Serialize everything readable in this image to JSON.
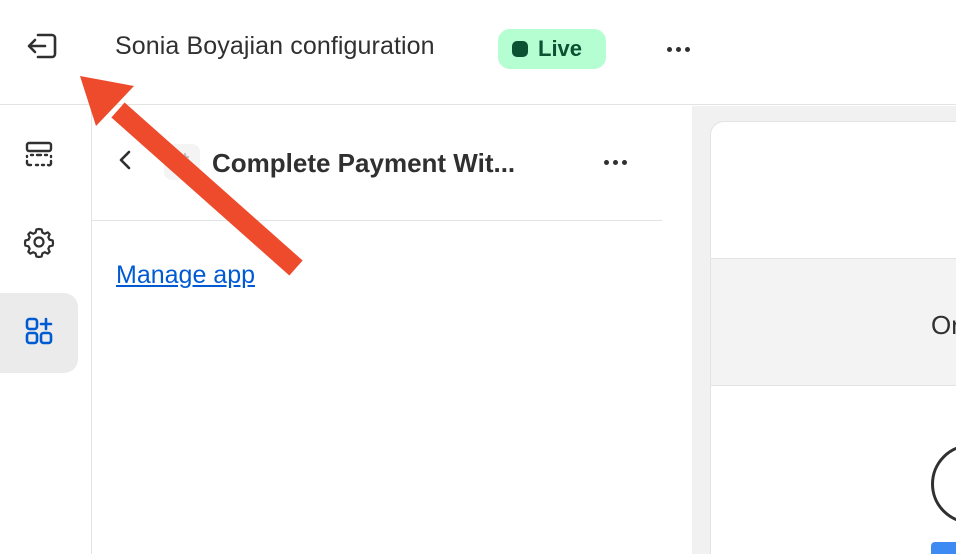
{
  "topbar": {
    "title": "Sonia Boyajian configuration",
    "status_badge": "Live",
    "status_color": "#0c5132",
    "status_bg": "#b4fed2",
    "exit_icon": "exit-icon",
    "more_icon": "more-horizontal-icon"
  },
  "rail": {
    "items": [
      {
        "icon": "sections-icon",
        "active": false
      },
      {
        "icon": "gear-icon",
        "active": false
      },
      {
        "icon": "apps-add-icon",
        "active": true
      }
    ],
    "accent": "#005bd3"
  },
  "panel": {
    "title": "Complete Payment Wit...",
    "manage_link": "Manage app",
    "back_icon": "chevron-left-icon",
    "app_icon": "app-icon",
    "more_icon": "more-horizontal-icon"
  },
  "preview": {
    "band_text": "Or"
  },
  "annotation": {
    "type": "arrow",
    "color": "#ee4a2c"
  }
}
